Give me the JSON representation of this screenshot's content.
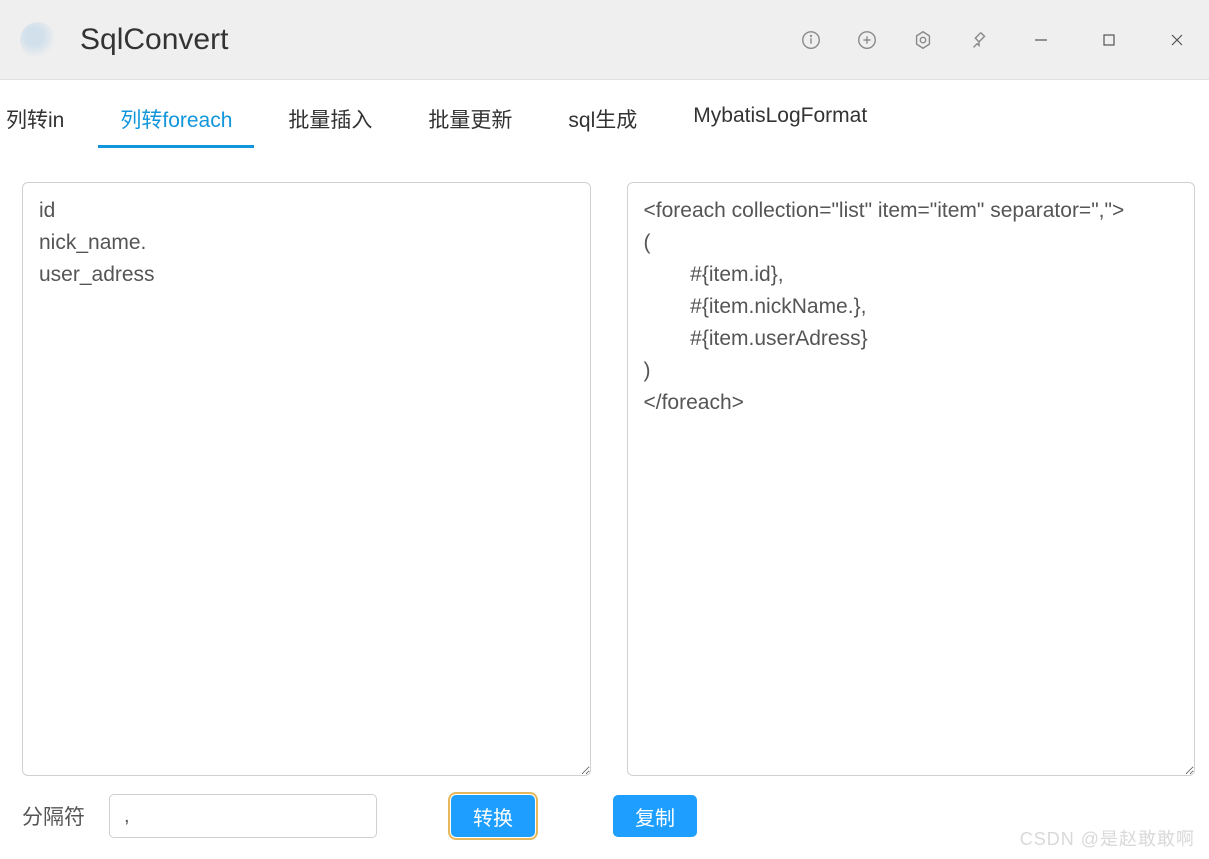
{
  "app": {
    "title": "SqlConvert"
  },
  "tabs": [
    {
      "label": "列转in"
    },
    {
      "label": "列转foreach"
    },
    {
      "label": "批量插入"
    },
    {
      "label": "批量更新"
    },
    {
      "label": "sql生成"
    },
    {
      "label": "MybatisLogFormat"
    }
  ],
  "activeTabIndex": 1,
  "input": {
    "value": "id\nnick_name.\nuser_adress"
  },
  "output": {
    "value": "<foreach collection=\"list\" item=\"item\" separator=\",\">\n(\n        #{item.id},\n        #{item.nickName.},\n        #{item.userAdress}\n)\n</foreach>"
  },
  "separator": {
    "label": "分隔符",
    "value": ","
  },
  "buttons": {
    "convert": "转换",
    "copy": "复制"
  },
  "watermark": "CSDN @是赵敢敢啊"
}
